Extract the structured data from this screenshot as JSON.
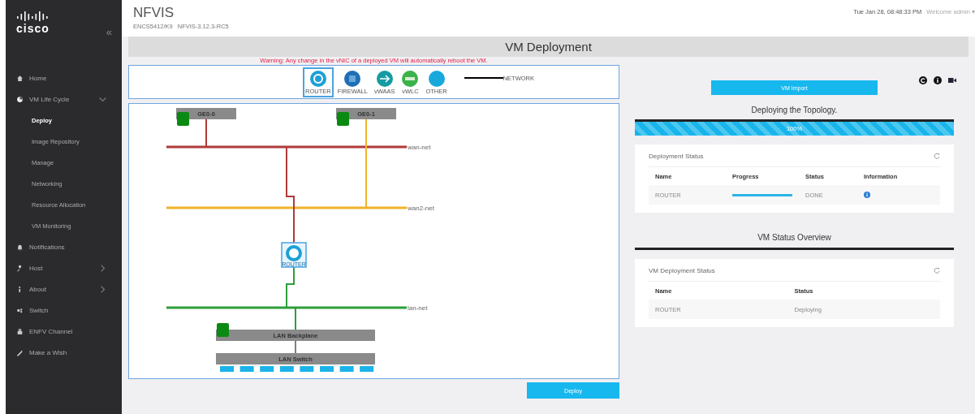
{
  "sidebar": {
    "logo": "cisco",
    "collapse": "«",
    "items": [
      {
        "label": "Home",
        "kind": "link",
        "selected": false
      },
      {
        "label": "VM Life Cycle",
        "kind": "group",
        "expanded": true,
        "selected": false,
        "children": [
          {
            "label": "Deploy",
            "selected": true
          },
          {
            "label": "Image Repository",
            "selected": false
          },
          {
            "label": "Manage",
            "selected": false
          },
          {
            "label": "Networking",
            "selected": false
          },
          {
            "label": "Resource Allocation",
            "selected": false
          },
          {
            "label": "VM Monitoring",
            "selected": false
          }
        ]
      },
      {
        "label": "Notifications",
        "kind": "link",
        "selected": false
      },
      {
        "label": "Host",
        "kind": "group",
        "expanded": false,
        "selected": false
      },
      {
        "label": "About",
        "kind": "group",
        "expanded": false,
        "selected": false
      },
      {
        "label": "Switch",
        "kind": "link",
        "selected": false
      },
      {
        "label": "ENFV Channel",
        "kind": "link",
        "selected": false
      },
      {
        "label": "Make a Wish",
        "kind": "link",
        "selected": false
      }
    ]
  },
  "header": {
    "title": "NFVIS",
    "model": "ENCS5412/K9",
    "version": "NFVIS-3.12.3-RC5",
    "datetime": "Tue Jan 28, 08:48:33 PM",
    "welcome": "Welcome admin ▾"
  },
  "page_title": "VM Deployment",
  "warning": "Warning: Any change in the vNIC of a deployed VM will automatically reboot the VM.",
  "palette": {
    "items": [
      {
        "label": "ROUTER",
        "selected": true
      },
      {
        "label": "FIREWALL",
        "selected": false
      },
      {
        "label": "vWAAS",
        "selected": false
      },
      {
        "label": "vWLC",
        "selected": false
      },
      {
        "label": "OTHER",
        "selected": false
      }
    ],
    "network_label": "NETWORK"
  },
  "topology": {
    "ports": [
      {
        "label": "GE0-0"
      },
      {
        "label": "GE0-1"
      }
    ],
    "networks": [
      {
        "label": "wan-net",
        "color": "#b03a3a"
      },
      {
        "label": "wan2-net",
        "color": "#f0b429"
      },
      {
        "label": "lan-net",
        "color": "#2e9e3a"
      }
    ],
    "router": {
      "label": "ROUTER"
    },
    "backplane": {
      "label": "LAN Backplane"
    },
    "switch": {
      "label": "LAN Switch"
    }
  },
  "deploy_button": "Deploy",
  "import_button": "VM Import",
  "deploy_progress": {
    "title": "Deploying the Topology.",
    "level": 1,
    "label": "100%"
  },
  "deployment_status": {
    "title": "Deployment Status",
    "columns": [
      "Name",
      "Progress",
      "Status",
      "Information"
    ],
    "rows": [
      {
        "name": "ROUTER",
        "level": 1,
        "status": "DONE"
      }
    ]
  },
  "overview_title": "VM Status Overview",
  "vm_status": {
    "title": "VM Deployment Status",
    "columns": [
      "Name",
      "Status"
    ],
    "rows": [
      {
        "name": "ROUTER",
        "status": "Deploying"
      }
    ]
  }
}
